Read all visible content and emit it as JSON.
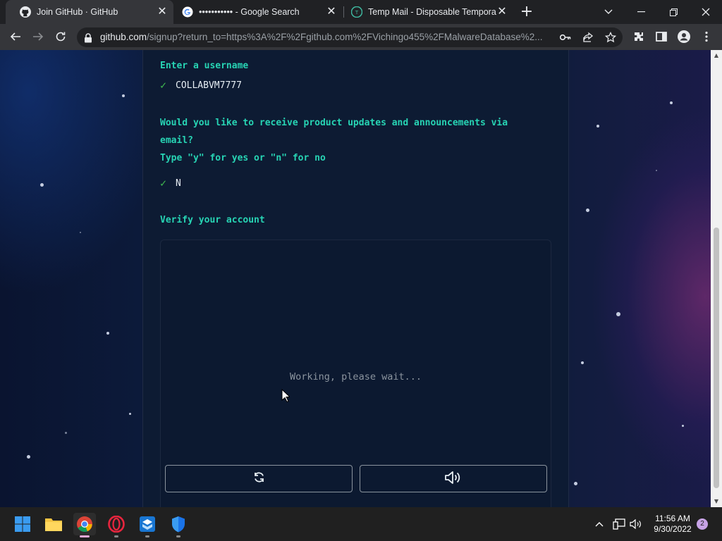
{
  "browser": {
    "tabs": [
      {
        "title": "Join GitHub · GitHub",
        "icon": "github-icon",
        "active": true
      },
      {
        "title": "••••••••••• - Google Search",
        "icon": "google-icon",
        "active": false
      },
      {
        "title": "Temp Mail - Disposable Tempora",
        "icon": "tempmail-icon",
        "active": false
      }
    ],
    "url_host": "github.com",
    "url_path": "/signup?return_to=https%3A%2F%2Fgithub.com%2FVichingo455%2FMalwareDatabase%2..."
  },
  "signup": {
    "username_prompt": "Enter a username",
    "username_value": "COLLABVM7777",
    "updates_prompt_line1": "Would you like to receive product updates and announcements via",
    "updates_prompt_line2": "email?",
    "updates_prompt_line3": "Type \"y\" for yes or \"n\" for no",
    "updates_value": "N",
    "verify_prompt": "Verify your account",
    "captcha_status": "Working, please wait..."
  },
  "taskbar": {
    "time": "11:56 AM",
    "date": "9/30/2022",
    "notification_count": "2"
  },
  "colors": {
    "prompt": "#27d4b4",
    "check": "#3fb950",
    "page_bg": "#0d1b33"
  }
}
